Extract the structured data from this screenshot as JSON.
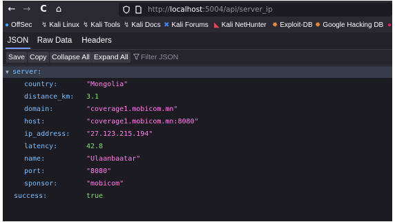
{
  "browser": {
    "back_glyph": "←",
    "forward_glyph": "→",
    "reload_glyph": "C",
    "home_glyph": "⌂",
    "url_prefix": "http://",
    "url_host": "localhost",
    "url_rest": ":5004/api/server_ip"
  },
  "bookmarks": [
    {
      "label": "OffSec",
      "icon": "offsec-icon",
      "color": "#4aa3ff"
    },
    {
      "label": "Kali Linux",
      "icon": "kali-dragon-icon",
      "color": "#cccccc"
    },
    {
      "label": "Kali Tools",
      "icon": "kali-dragon-icon",
      "color": "#cccccc"
    },
    {
      "label": "Kali Docs",
      "icon": "kali-dragon-icon",
      "color": "#cccccc"
    },
    {
      "label": "Kali Forums",
      "icon": "kali-x-icon",
      "color": "#3b82f6"
    },
    {
      "label": "Kali NetHunter",
      "icon": "nethunter-icon",
      "color": "#e34b4b"
    },
    {
      "label": "Exploit-DB",
      "icon": "exploit-db-icon",
      "color": "#f08a3b"
    },
    {
      "label": "Google Hacking DB",
      "icon": "ghdb-icon",
      "color": "#f08a3b"
    }
  ],
  "tabs": [
    "JSON",
    "Raw Data",
    "Headers"
  ],
  "toolbar": {
    "save": "Save",
    "copy": "Copy",
    "collapse_all": "Collapse All",
    "expand_all": "Expand All",
    "filter_placeholder": "Filter JSON"
  },
  "json": {
    "root_key": "server:",
    "fields": [
      {
        "key": "country:",
        "value": "\"Mongolia\"",
        "type": "str"
      },
      {
        "key": "distance_km:",
        "value": "3.1",
        "type": "num"
      },
      {
        "key": "domain:",
        "value": "\"coverage1.mobicom.mn\"",
        "type": "str"
      },
      {
        "key": "host:",
        "value": "\"coverage1.mobicom.mn:8080\"",
        "type": "str"
      },
      {
        "key": "ip_address:",
        "value": "\"27.123.215.194\"",
        "type": "str"
      },
      {
        "key": "latency:",
        "value": "42.8",
        "type": "num"
      },
      {
        "key": "name:",
        "value": "\"Ulaanbaatar\"",
        "type": "str"
      },
      {
        "key": "port:",
        "value": "\"8080\"",
        "type": "str"
      },
      {
        "key": "sponsor:",
        "value": "\"mobicom\"",
        "type": "str"
      }
    ],
    "success_key": "success:",
    "success_value": "true"
  }
}
